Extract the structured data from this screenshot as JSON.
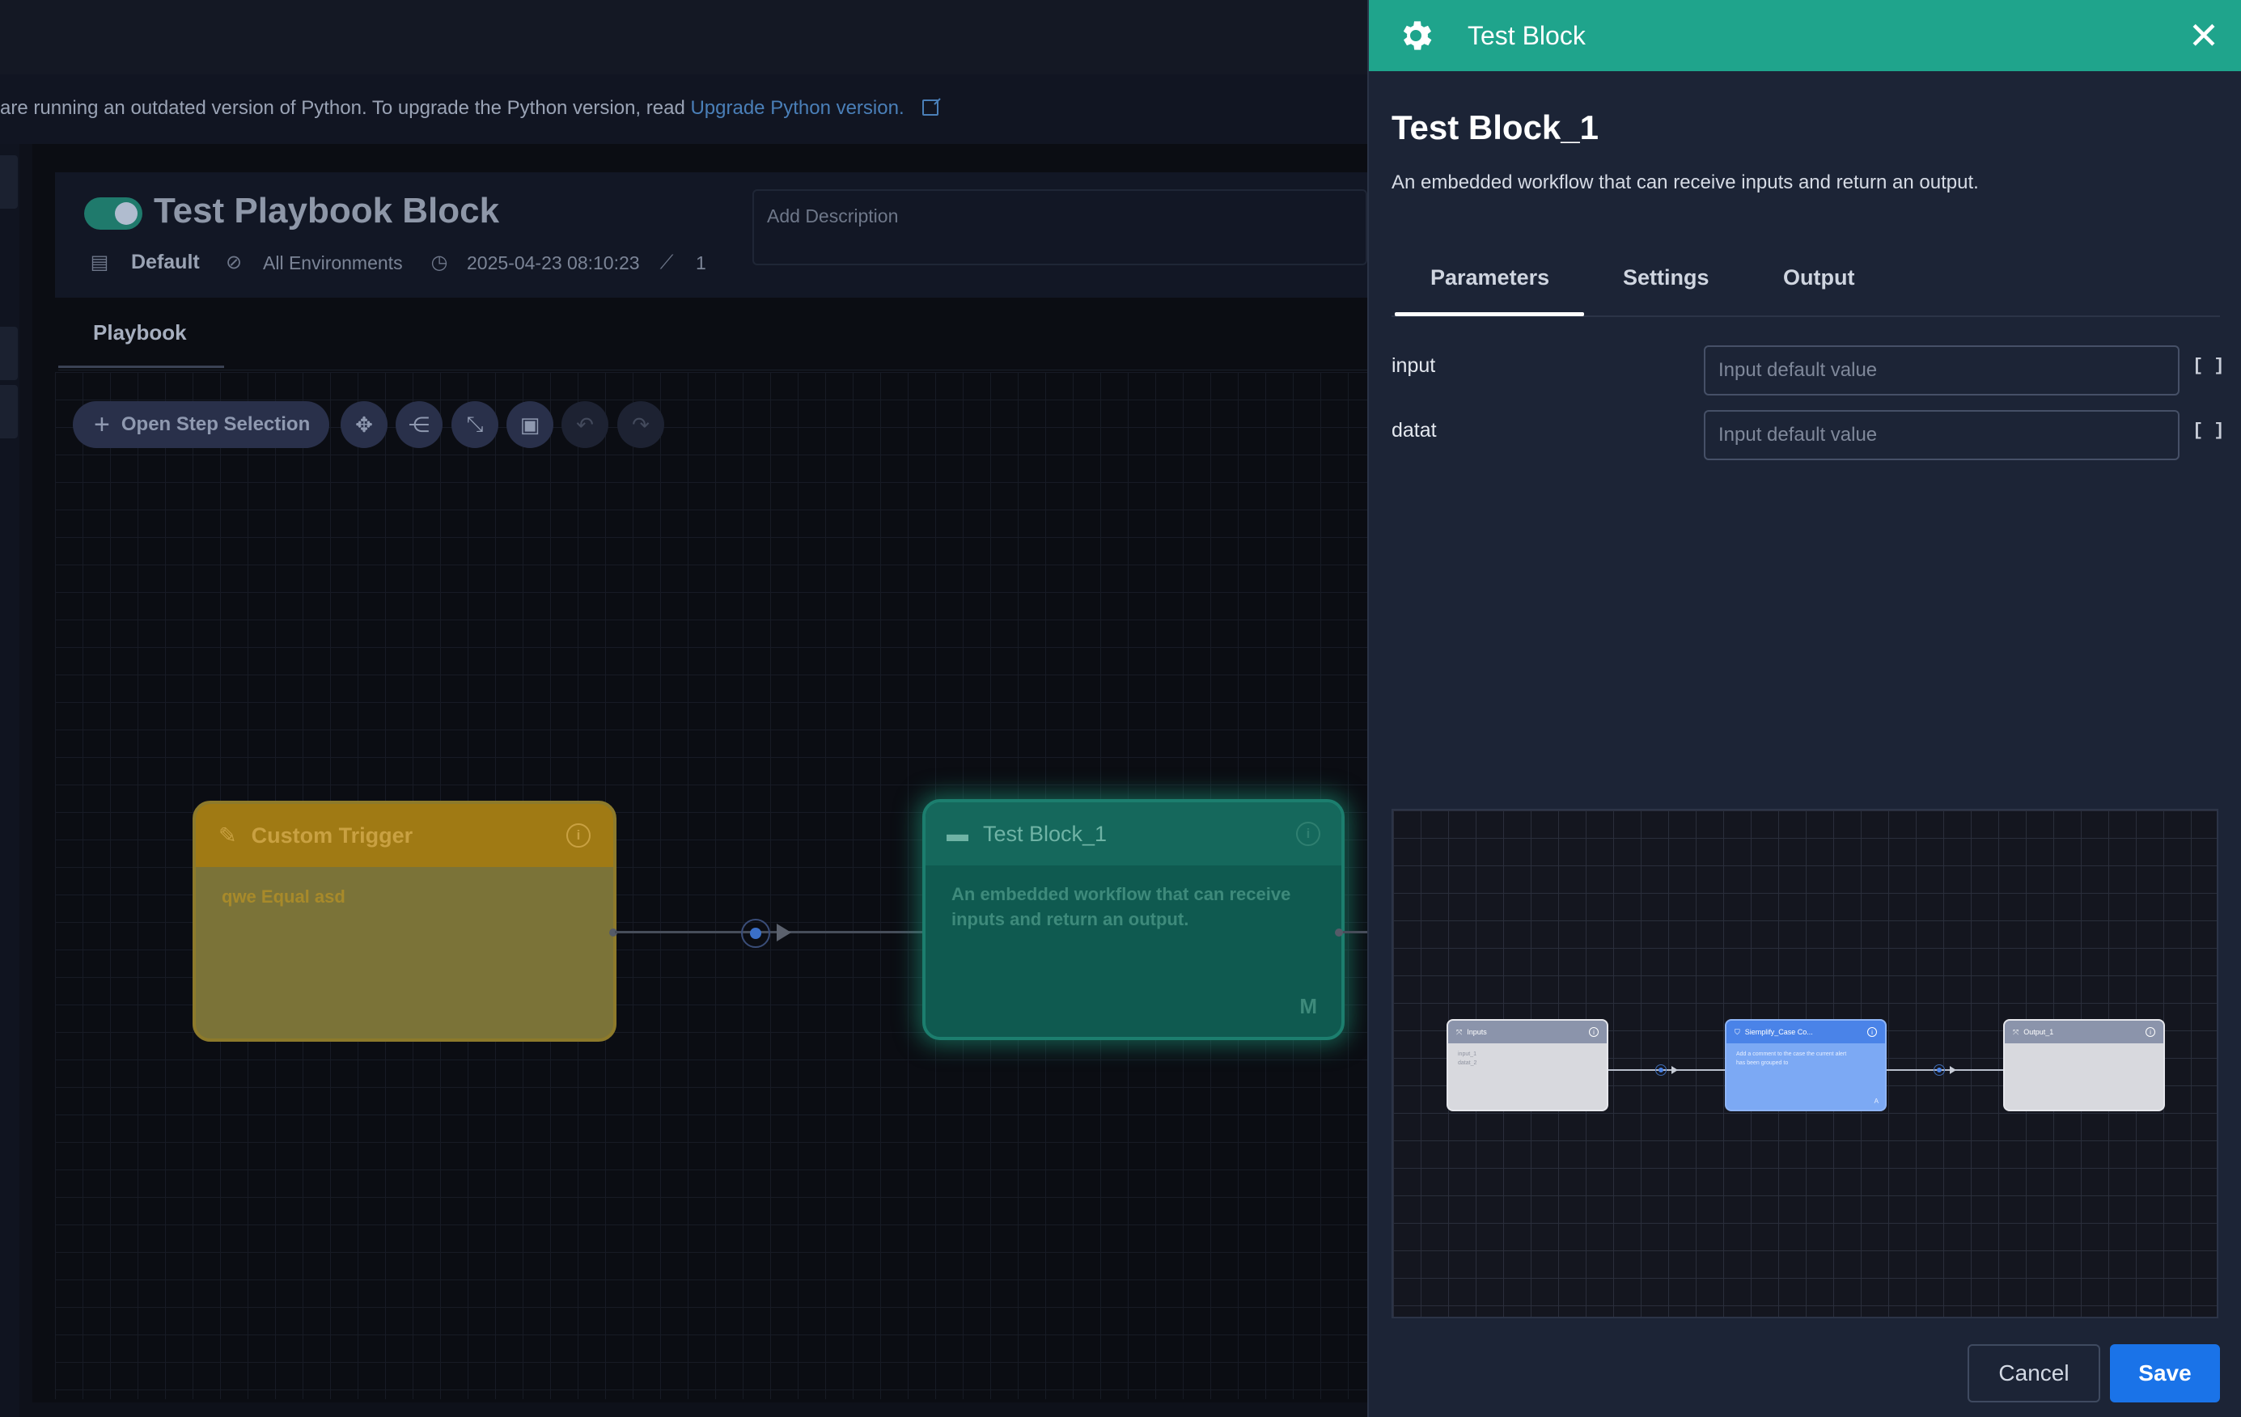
{
  "banner": {
    "text": "are running an outdated version of Python. To upgrade the Python version, read",
    "link": "Upgrade Python version."
  },
  "playbook": {
    "title": "Test Playbook Block",
    "enabled": true,
    "folder": "Default",
    "environment": "All Environments",
    "timestamp": "2025-04-23 08:10:23",
    "steps_count": "1",
    "description_placeholder": "Add Description",
    "tab": "Playbook"
  },
  "toolbar": {
    "open_step_selection": "Open Step Selection"
  },
  "canvas": {
    "trigger_node": {
      "title": "Custom Trigger",
      "body": "qwe Equal asd"
    },
    "block_node": {
      "title": "Test Block_1",
      "body": "An embedded workflow that can receive inputs and return an output.",
      "badge": "M"
    }
  },
  "panel": {
    "header_title": "Test Block",
    "name": "Test Block_1",
    "description": "An embedded workflow that can receive inputs and return an output.",
    "tabs": [
      {
        "label": "Parameters",
        "active": true
      },
      {
        "label": "Settings",
        "active": false
      },
      {
        "label": "Output",
        "active": false
      }
    ],
    "parameters": [
      {
        "label": "input",
        "value": "",
        "placeholder": "Input default value",
        "suffix": "[ ]"
      },
      {
        "label": "datat",
        "value": "",
        "placeholder": "Input default value",
        "suffix": "[ ]"
      }
    ],
    "preview": {
      "nodes": [
        {
          "title": "Inputs",
          "lines": [
            "input_1",
            "datat_2"
          ],
          "badge": ""
        },
        {
          "title": "Siemplify_Case Co...",
          "lines": [
            "Add a comment to the case the current alert",
            "has been grouped to"
          ],
          "badge": "A"
        },
        {
          "title": "Output_1",
          "lines": [],
          "badge": ""
        }
      ]
    },
    "buttons": {
      "cancel": "Cancel",
      "save": "Save"
    }
  },
  "colors": {
    "panel_header": "#1fa48c",
    "save_button": "#1a73e8",
    "trigger_node": "#a07a14",
    "block_node": "#15685c"
  }
}
